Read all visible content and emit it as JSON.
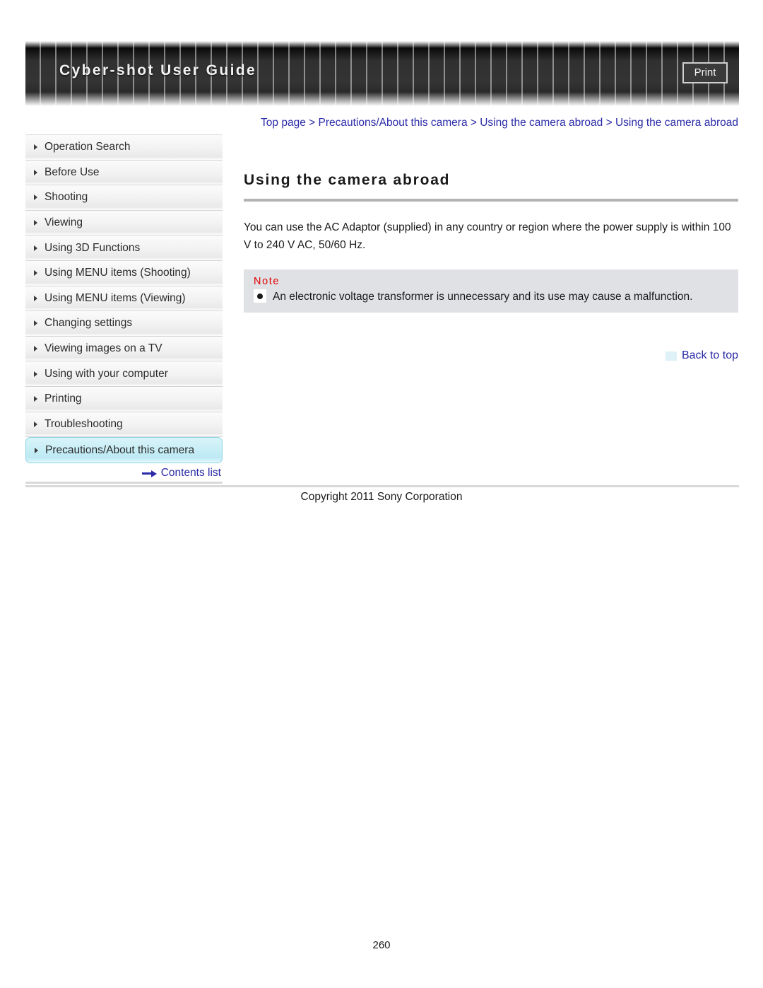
{
  "header": {
    "title": "Cyber-shot User Guide",
    "print_label": "Print"
  },
  "breadcrumb": {
    "text": "Top page > Precautions/About this camera > Using the camera abroad > Using the camera abroad"
  },
  "sidebar": {
    "items": [
      {
        "label": "Operation Search",
        "selected": false
      },
      {
        "label": "Before Use",
        "selected": false
      },
      {
        "label": "Shooting",
        "selected": false
      },
      {
        "label": "Viewing",
        "selected": false
      },
      {
        "label": "Using 3D Functions",
        "selected": false
      },
      {
        "label": "Using MENU items (Shooting)",
        "selected": false
      },
      {
        "label": "Using MENU items (Viewing)",
        "selected": false
      },
      {
        "label": "Changing settings",
        "selected": false
      },
      {
        "label": "Viewing images on a TV",
        "selected": false
      },
      {
        "label": "Using with your computer",
        "selected": false
      },
      {
        "label": "Printing",
        "selected": false
      },
      {
        "label": "Troubleshooting",
        "selected": false
      },
      {
        "label": "Precautions/About this camera",
        "selected": true
      }
    ],
    "contents_list_label": "Contents list"
  },
  "main": {
    "heading": "Using the camera abroad",
    "paragraph": "You can use the AC Adaptor (supplied) in any country or region where the power supply is within 100 V to 240 V AC, 50/60 Hz.",
    "note": {
      "title": "Note",
      "items": [
        "An electronic voltage transformer is unnecessary and its use may cause a malfunction."
      ]
    },
    "back_to_top_label": "Back to top"
  },
  "footer": {
    "copyright": "Copyright 2011 Sony Corporation",
    "page_number": "260"
  },
  "colors": {
    "link": "#2a2aa8",
    "note_title": "#e10000",
    "selected_item": "#bde9f4",
    "note_background": "#dfe1e5"
  }
}
